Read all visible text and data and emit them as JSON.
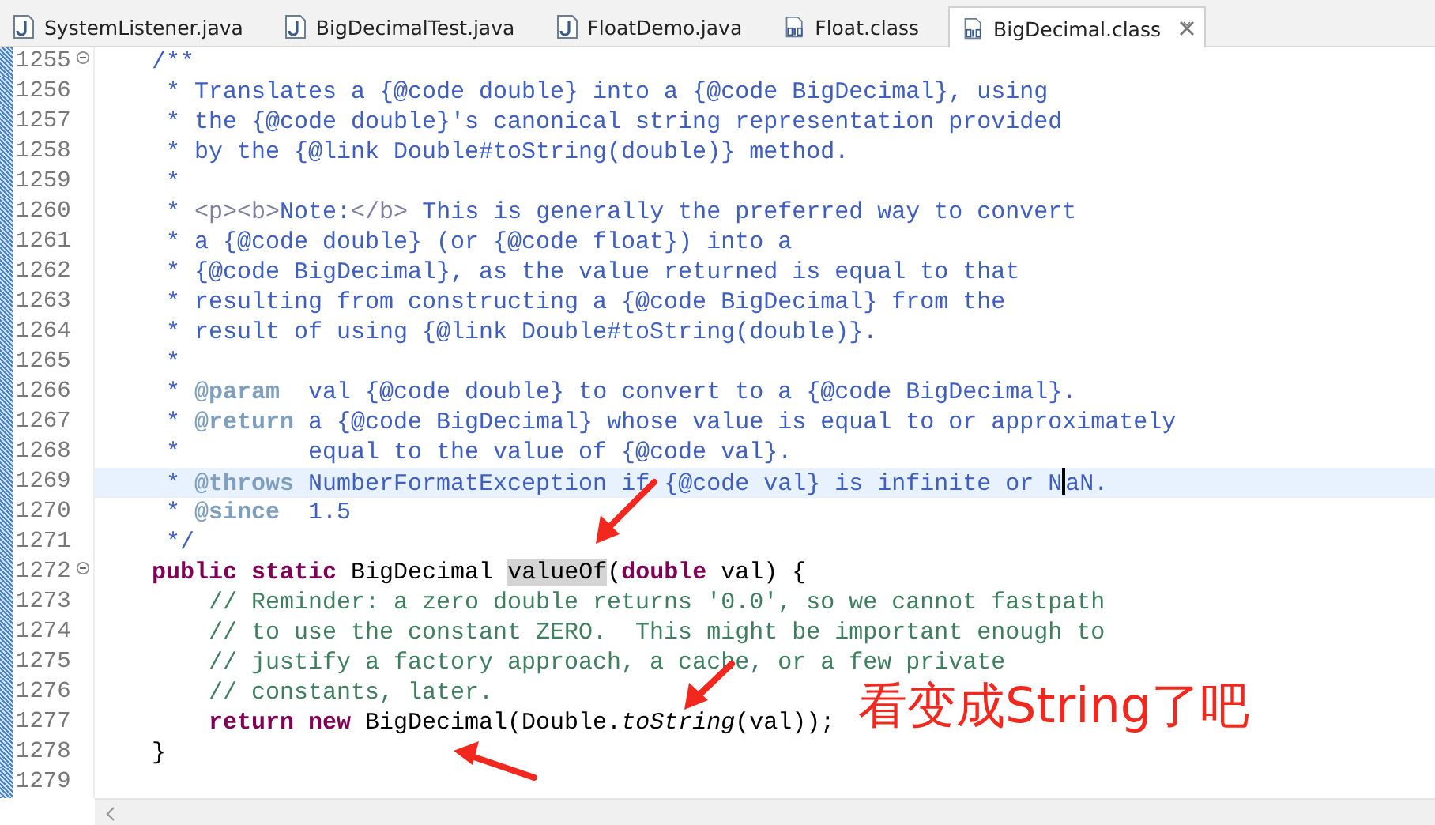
{
  "tabs": [
    {
      "label": "SystemListener.java",
      "kind": "java",
      "selected": false
    },
    {
      "label": "BigDecimalTest.java",
      "kind": "java",
      "selected": false
    },
    {
      "label": "FloatDemo.java",
      "kind": "java",
      "selected": false
    },
    {
      "label": "Float.class",
      "kind": "class",
      "selected": false
    },
    {
      "label": "BigDecimal.class",
      "kind": "class",
      "selected": true
    }
  ],
  "editor": {
    "lines": [
      {
        "number": "1255",
        "collapsible": true,
        "current": false,
        "segments": [
          {
            "kind": "doc",
            "text": "    /**"
          }
        ]
      },
      {
        "number": "1256",
        "collapsible": false,
        "current": false,
        "segments": [
          {
            "kind": "doc",
            "text": "     * Translates a {@code double} into a {@code BigDecimal}, using"
          }
        ]
      },
      {
        "number": "1257",
        "collapsible": false,
        "current": false,
        "segments": [
          {
            "kind": "doc",
            "text": "     * the {@code double}'s canonical string representation provided"
          }
        ]
      },
      {
        "number": "1258",
        "collapsible": false,
        "current": false,
        "segments": [
          {
            "kind": "doc",
            "text": "     * by the {@link Double#toString(double)} method."
          }
        ]
      },
      {
        "number": "1259",
        "collapsible": false,
        "current": false,
        "segments": [
          {
            "kind": "doc",
            "text": "     *"
          }
        ]
      },
      {
        "number": "1260",
        "collapsible": false,
        "current": false,
        "segments": [
          {
            "kind": "doc",
            "text": "     * "
          },
          {
            "kind": "html",
            "text": "<p><b>"
          },
          {
            "kind": "doc",
            "text": "Note:"
          },
          {
            "kind": "html",
            "text": "</b>"
          },
          {
            "kind": "doc",
            "text": " This is generally the preferred way to convert"
          }
        ]
      },
      {
        "number": "1261",
        "collapsible": false,
        "current": false,
        "segments": [
          {
            "kind": "doc",
            "text": "     * a {@code double} (or {@code float}) into a"
          }
        ]
      },
      {
        "number": "1262",
        "collapsible": false,
        "current": false,
        "segments": [
          {
            "kind": "doc",
            "text": "     * {@code BigDecimal}, as the value returned is equal to that"
          }
        ]
      },
      {
        "number": "1263",
        "collapsible": false,
        "current": false,
        "segments": [
          {
            "kind": "doc",
            "text": "     * resulting from constructing a {@code BigDecimal} from the"
          }
        ]
      },
      {
        "number": "1264",
        "collapsible": false,
        "current": false,
        "segments": [
          {
            "kind": "doc",
            "text": "     * result of using {@link Double#toString(double)}."
          }
        ]
      },
      {
        "number": "1265",
        "collapsible": false,
        "current": false,
        "segments": [
          {
            "kind": "doc",
            "text": "     *"
          }
        ]
      },
      {
        "number": "1266",
        "collapsible": false,
        "current": false,
        "segments": [
          {
            "kind": "doc",
            "text": "     * "
          },
          {
            "kind": "tag",
            "text": "@param"
          },
          {
            "kind": "doc",
            "text": "  val {@code double} to convert to a {@code BigDecimal}."
          }
        ]
      },
      {
        "number": "1267",
        "collapsible": false,
        "current": false,
        "segments": [
          {
            "kind": "doc",
            "text": "     * "
          },
          {
            "kind": "tag",
            "text": "@return"
          },
          {
            "kind": "doc",
            "text": " a {@code BigDecimal} whose value is equal to or approximately"
          }
        ]
      },
      {
        "number": "1268",
        "collapsible": false,
        "current": false,
        "segments": [
          {
            "kind": "doc",
            "text": "     *         equal to the value of {@code val}."
          }
        ]
      },
      {
        "number": "1269",
        "collapsible": false,
        "current": true,
        "segments": [
          {
            "kind": "doc",
            "text": "     * "
          },
          {
            "kind": "tag",
            "text": "@throws"
          },
          {
            "kind": "doc",
            "text": " NumberFormatException if {@code val} is infinite or N"
          },
          {
            "kind": "caret"
          },
          {
            "kind": "doc",
            "text": "aN."
          }
        ]
      },
      {
        "number": "1270",
        "collapsible": false,
        "current": false,
        "segments": [
          {
            "kind": "doc",
            "text": "     * "
          },
          {
            "kind": "tag",
            "text": "@since"
          },
          {
            "kind": "doc",
            "text": "  1.5"
          }
        ]
      },
      {
        "number": "1271",
        "collapsible": false,
        "current": false,
        "segments": [
          {
            "kind": "doc",
            "text": "     */"
          }
        ]
      },
      {
        "number": "1272",
        "collapsible": true,
        "current": false,
        "segments": [
          {
            "kind": "keyword",
            "text": "    public static"
          },
          {
            "kind": "plain",
            "text": " BigDecimal "
          },
          {
            "kind": "occurrence",
            "text": "valueOf"
          },
          {
            "kind": "plain",
            "text": "("
          },
          {
            "kind": "keyword",
            "text": "double"
          },
          {
            "kind": "plain",
            "text": " val) {"
          }
        ]
      },
      {
        "number": "1273",
        "collapsible": false,
        "current": false,
        "segments": [
          {
            "kind": "comment",
            "text": "        // Reminder: a zero double returns '0.0', so we cannot fastpath"
          }
        ]
      },
      {
        "number": "1274",
        "collapsible": false,
        "current": false,
        "segments": [
          {
            "kind": "comment",
            "text": "        // to use the constant ZERO.  This might be important enough to"
          }
        ]
      },
      {
        "number": "1275",
        "collapsible": false,
        "current": false,
        "segments": [
          {
            "kind": "comment",
            "text": "        // justify a factory approach, a cache, or a few private"
          }
        ]
      },
      {
        "number": "1276",
        "collapsible": false,
        "current": false,
        "segments": [
          {
            "kind": "comment",
            "text": "        // constants, later."
          }
        ]
      },
      {
        "number": "1277",
        "collapsible": false,
        "current": false,
        "segments": [
          {
            "kind": "keyword",
            "text": "        return new"
          },
          {
            "kind": "plain",
            "text": " BigDecimal(Double."
          },
          {
            "kind": "italic",
            "text": "toString"
          },
          {
            "kind": "plain",
            "text": "(val));"
          }
        ]
      },
      {
        "number": "1278",
        "collapsible": false,
        "current": false,
        "segments": [
          {
            "kind": "plain",
            "text": "    }"
          }
        ]
      },
      {
        "number": "1279",
        "collapsible": false,
        "current": false
      }
    ]
  },
  "annotation": {
    "text": "看变成String了吧"
  }
}
